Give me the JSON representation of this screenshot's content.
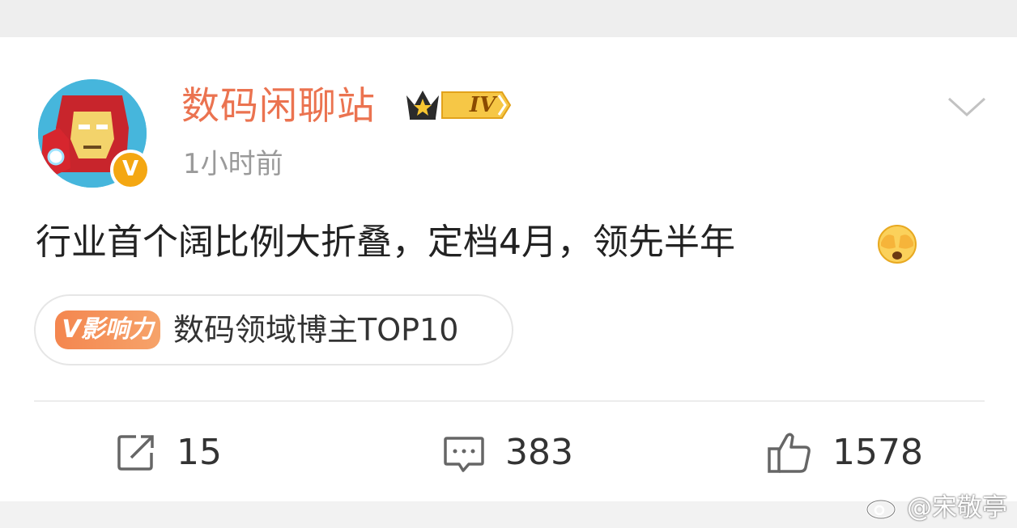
{
  "post": {
    "author": {
      "name": "数码闲聊站",
      "level_badge": "IV",
      "verified_mark": "V"
    },
    "time": "1小时前",
    "text": "行业首个阔比例大折叠，定档4月，领先半年",
    "emoji": "face-covering-eyes-emoji",
    "influence": {
      "tag": "V影响力",
      "label": "数码领域博主TOP10"
    },
    "actions": {
      "repost_count": "15",
      "comment_count": "383",
      "like_count": "1578"
    }
  },
  "watermark": {
    "text": "@宋敬亭"
  },
  "colors": {
    "username": "#eb7350",
    "tag": "#f4864f",
    "muted": "#9a9a9a",
    "text": "#222222"
  }
}
